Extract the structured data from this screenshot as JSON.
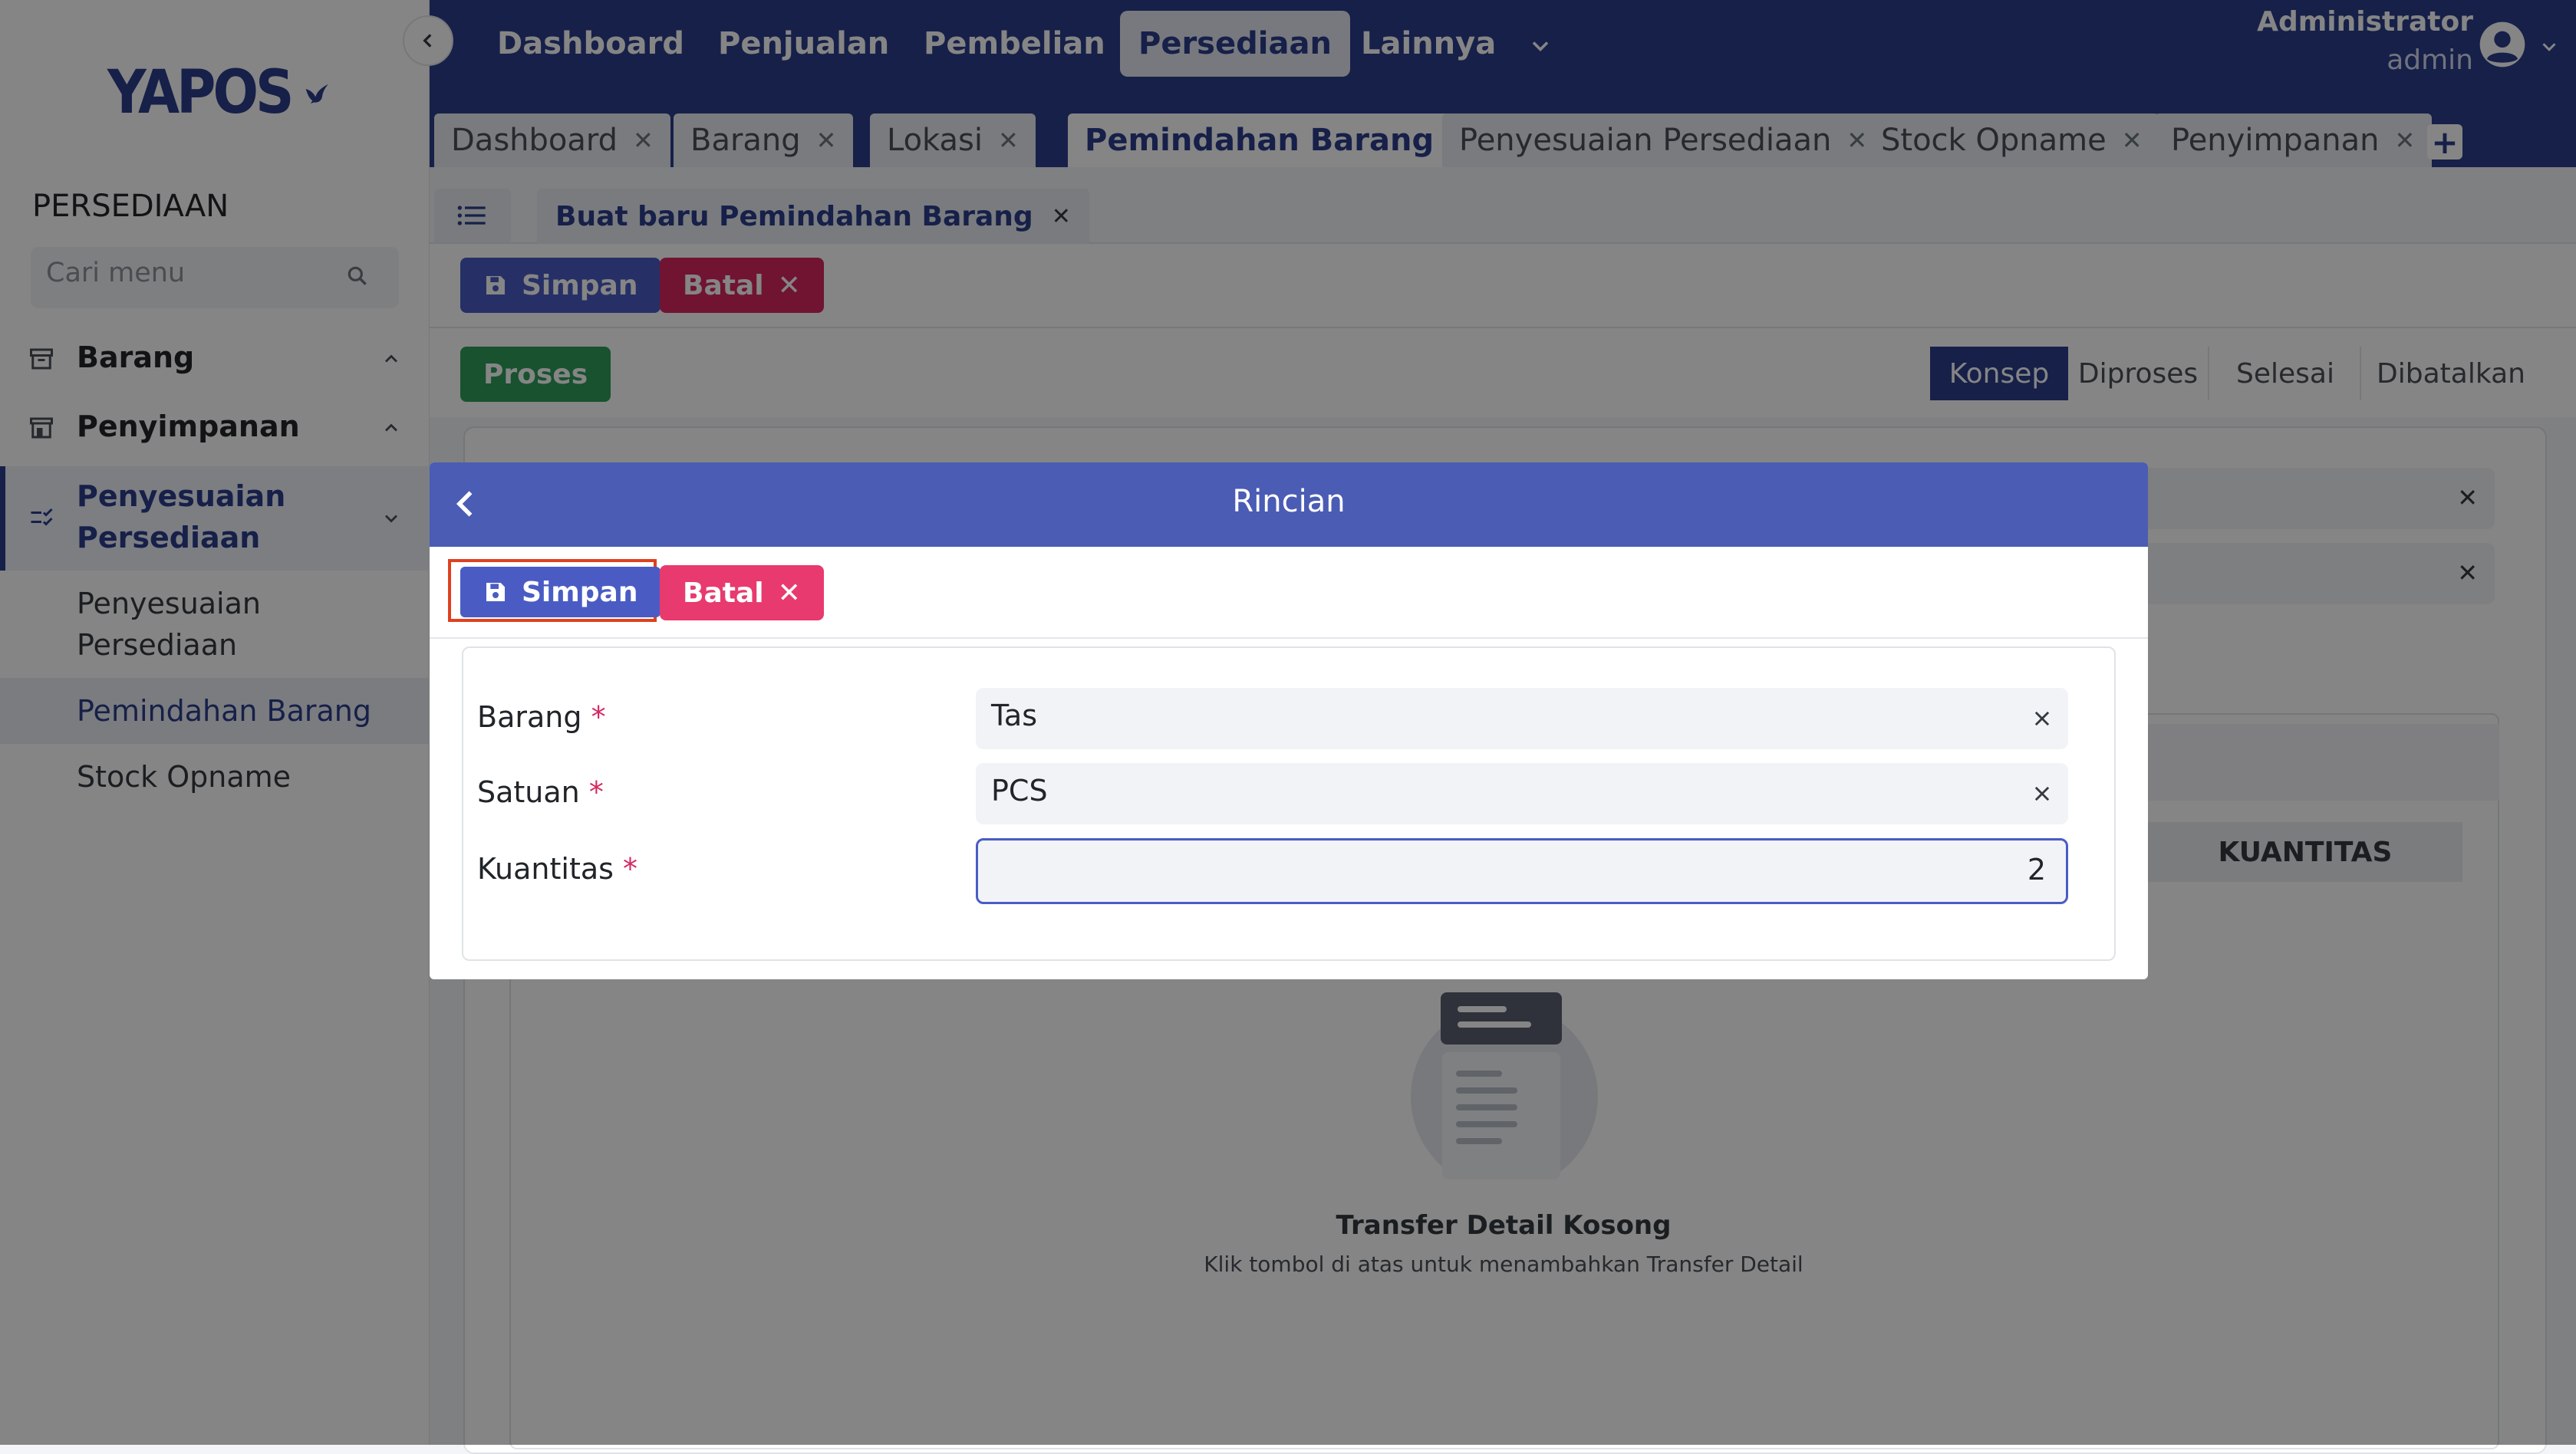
{
  "app": {
    "logo_text": "YAPOS"
  },
  "topnav": {
    "items": [
      "Dashboard",
      "Penjualan",
      "Pembelian",
      "Persediaan",
      "Lainnya"
    ],
    "active": "Persediaan",
    "user_name": "Administrator",
    "user_role": "admin"
  },
  "tabs": [
    {
      "label": "Dashboard",
      "active": false
    },
    {
      "label": "Barang",
      "active": false
    },
    {
      "label": "Lokasi",
      "active": false
    },
    {
      "label": "Pemindahan Barang",
      "active": true
    },
    {
      "label": "Penyesuaian Persediaan",
      "active": false
    },
    {
      "label": "Stock Opname",
      "active": false
    },
    {
      "label": "Penyimpanan",
      "active": false
    }
  ],
  "sidebar": {
    "section_title": "PERSEDIAAN",
    "search_placeholder": "Cari menu",
    "groups": [
      {
        "label": "Barang",
        "icon": "archive-icon",
        "expanded": false
      },
      {
        "label": "Penyimpanan",
        "icon": "store-icon",
        "expanded": false
      },
      {
        "label": "Penyesuaian Persediaan",
        "icon": "checklist-icon",
        "expanded": true
      }
    ],
    "sub_items": [
      "Penyesuaian Persediaan",
      "Pemindahan Barang",
      "Stock Opname"
    ],
    "active_sub": "Pemindahan Barang"
  },
  "breadcrumb": {
    "doc_tab": "Buat baru Pemindahan Barang"
  },
  "actions": {
    "save": "Simpan",
    "cancel": "Batal",
    "process": "Proses"
  },
  "status_steps": [
    "Konsep",
    "Diproses",
    "Selesai",
    "Dibatalkan"
  ],
  "active_status": "Konsep",
  "detail_table": {
    "column_kuantitas": "KUANTITAS",
    "empty_title": "Transfer Detail Kosong",
    "empty_desc": "Klik tombol di atas untuk menambahkan Transfer Detail"
  },
  "modal": {
    "title": "Rincian",
    "save": "Simpan",
    "cancel": "Batal",
    "fields": [
      {
        "label": "Barang",
        "value": "Tas"
      },
      {
        "label": "Satuan",
        "value": "PCS"
      },
      {
        "label": "Kuantitas",
        "value": "2"
      }
    ]
  },
  "colors": {
    "primary": "#2b3f8c",
    "accent_blue": "#4a5cc4",
    "danger": "#d6285f",
    "success": "#2e9e5a"
  }
}
